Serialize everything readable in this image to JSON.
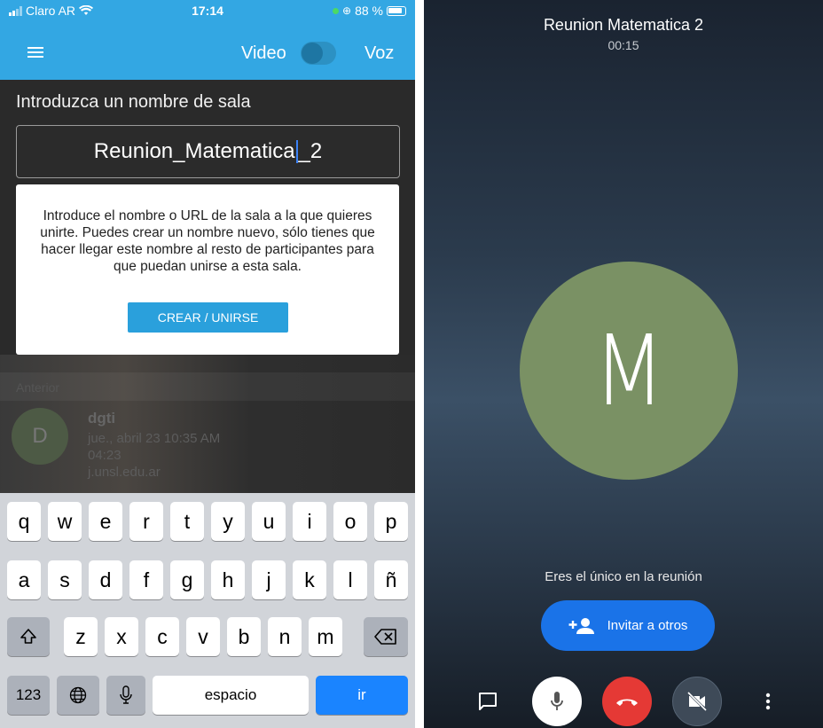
{
  "left_screen": {
    "status_bar": {
      "carrier": "Claro AR",
      "time": "17:14",
      "battery": "88 %"
    },
    "app_bar": {
      "video_label": "Video",
      "voice_label": "Voz"
    },
    "room_prompt": "Introduzca un nombre de sala",
    "room_input": {
      "value_before_caret": "Reunion_Matematica",
      "value_after_caret": "_2"
    },
    "info_card": {
      "text": "Introduce el nombre o URL de la sala a la que quieres unirte. Puedes crear un nombre nuevo, sólo tienes que hacer llegar este nombre al resto de participantes para que puedan unirse a esta sala.",
      "button_label": "CREAR / UNIRSE"
    },
    "recent": {
      "header": "Anterior",
      "item": {
        "avatar_letter": "D",
        "name": "dgti",
        "date": "jue., abril 23 10:35 AM",
        "duration": "04:23",
        "url": "j.unsl.edu.ar"
      }
    },
    "keyboard": {
      "row1": [
        "q",
        "w",
        "e",
        "r",
        "t",
        "y",
        "u",
        "i",
        "o",
        "p"
      ],
      "row2": [
        "a",
        "s",
        "d",
        "f",
        "g",
        "h",
        "j",
        "k",
        "l",
        "ñ"
      ],
      "row3": [
        "z",
        "x",
        "c",
        "v",
        "b",
        "n",
        "m"
      ],
      "numbers_key": "123",
      "space_key": "espacio",
      "go_key": "ir"
    }
  },
  "right_screen": {
    "meeting_title": "Reunion Matematica 2",
    "timer": "00:15",
    "avatar_letter": "M",
    "alone_message": "Eres el único en la reunión",
    "invite_label": "Invitar a otros"
  },
  "colors": {
    "app_bar": "#33a7e3",
    "join_button": "#2aa0dc",
    "avatar_green": "#7a9164",
    "invite_blue": "#1a73e8",
    "hangup_red": "#e53935",
    "keyboard_go": "#1a84ff"
  },
  "icons": [
    "menu-icon",
    "wifi-icon",
    "battery-icon",
    "shift-icon",
    "backspace-icon",
    "globe-icon",
    "mic-icon",
    "chat-icon",
    "hangup-icon",
    "camera-off-icon",
    "more-vert-icon",
    "add-person-icon"
  ]
}
